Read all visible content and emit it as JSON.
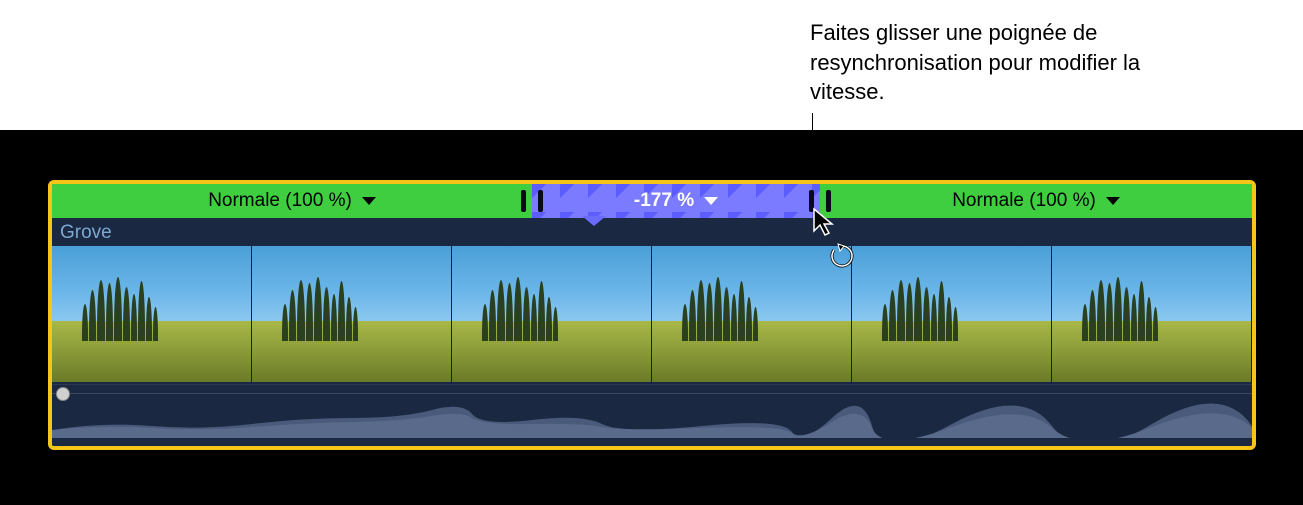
{
  "annotation": {
    "text": "Faites glisser une poignée de resynchronisation pour modifier la vitesse."
  },
  "clip": {
    "name": "Grove"
  },
  "speed_segments": [
    {
      "label": "Normale (100 %)",
      "type": "normal",
      "width_percent": 40
    },
    {
      "label": "-177 %",
      "type": "reverse",
      "width_percent": 24
    },
    {
      "label": "Normale (100 %)",
      "type": "normal",
      "width_percent": 36
    }
  ],
  "icons": {
    "chevron_down": "chevron-down",
    "cursor": "cursor-arrow",
    "refresh": "refresh-circle"
  },
  "colors": {
    "selection_border": "#f5c518",
    "normal_speed": "#3fce3f",
    "reverse_speed": "#6b6bff",
    "clip_background": "#1a2842"
  }
}
